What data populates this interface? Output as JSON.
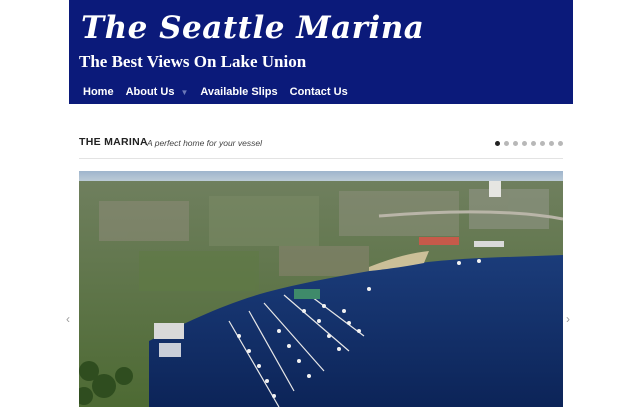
{
  "site": {
    "title": "The Seattle Marina",
    "tagline": "The Best Views On Lake Union"
  },
  "nav": {
    "items": [
      {
        "label": "Home"
      },
      {
        "label": "About Us",
        "dropdown_icon": "chevron-down-icon"
      },
      {
        "label": "Available Slips"
      },
      {
        "label": "Contact Us"
      }
    ]
  },
  "section": {
    "title": "THE MARINA",
    "subtitle": "A perfect home for your vessel"
  },
  "slider": {
    "total_slides": 8,
    "active_slide": 1,
    "prev_icon": "chevron-left-icon",
    "next_icon": "chevron-right-icon"
  },
  "colors": {
    "header_bg": "#0b1a7a",
    "water": "#0f2d6b",
    "active_dot": "#222222",
    "inactive_dot": "#b8b8b8"
  }
}
